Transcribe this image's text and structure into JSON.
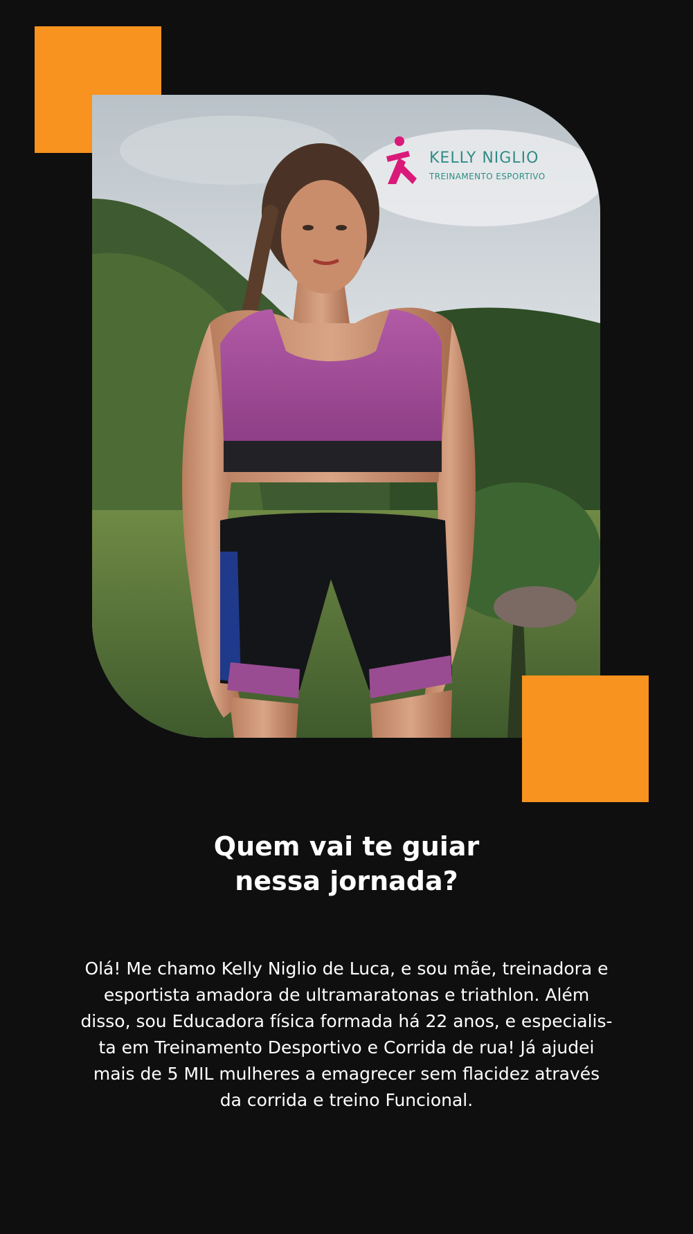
{
  "brand": {
    "name": "KELLY NIGLIO",
    "tagline": "TREINAMENTO ESPORTIVO",
    "mark_icon": "kelly-niglio-logo-icon",
    "mark_color": "#d91a79",
    "text_color": "#2f8c86"
  },
  "colors": {
    "background": "#0f0f0f",
    "accent": "#f7931e",
    "text": "#ffffff"
  },
  "photo": {
    "subject": "trainer-portrait-photo"
  },
  "section": {
    "title_line1": "Quem vai te guiar",
    "title_line2": "nessa jornada?",
    "bio_lines": [
      "Olá! Me chamo Kelly Niglio de Luca, e sou mãe, treinadora e",
      "esportista amadora de ultramaratonas e triathlon. Além",
      "disso, sou Educadora física formada há 22 anos, e especialis-",
      "ta em Treinamento Desportivo e Corrida de rua! Já ajudei",
      "mais de 5 MIL mulheres a emagrecer sem flacidez através",
      "da corrida e treino Funcional."
    ]
  }
}
